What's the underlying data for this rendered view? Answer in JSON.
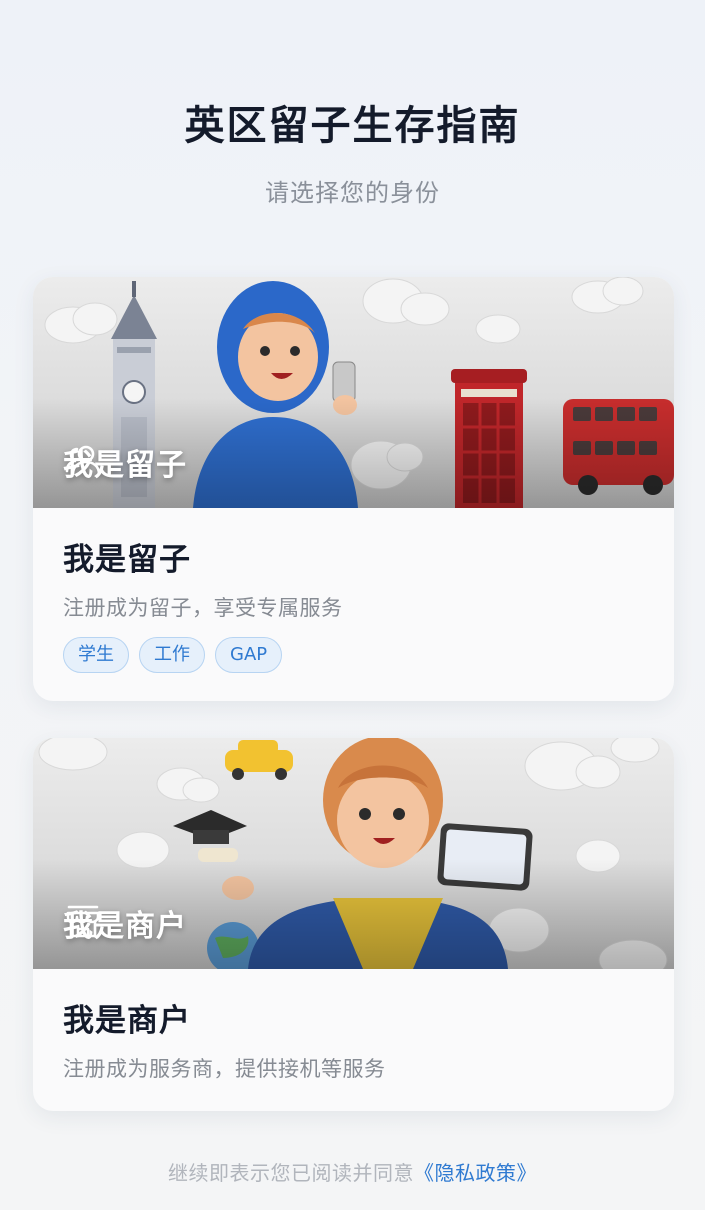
{
  "header": {
    "title": "英区留子生存指南",
    "subtitle": "请选择您的身份"
  },
  "cards": [
    {
      "id": "student",
      "banner_label": "我是留子",
      "icon": "user-group-icon",
      "title": "我是留子",
      "description": "注册成为留子，享受专属服务",
      "tags": [
        "学生",
        "工作",
        "GAP"
      ]
    },
    {
      "id": "merchant",
      "banner_label": "我是商户",
      "icon": "storefront-icon",
      "title": "我是商户",
      "description": "注册成为服务商，提供接机等服务"
    }
  ],
  "footer": {
    "text": "继续即表示您已阅读并同意",
    "link": "《隐私政策》"
  },
  "colors": {
    "accent": "#2f7ad1",
    "title": "#141b2b",
    "muted": "#868b93"
  }
}
